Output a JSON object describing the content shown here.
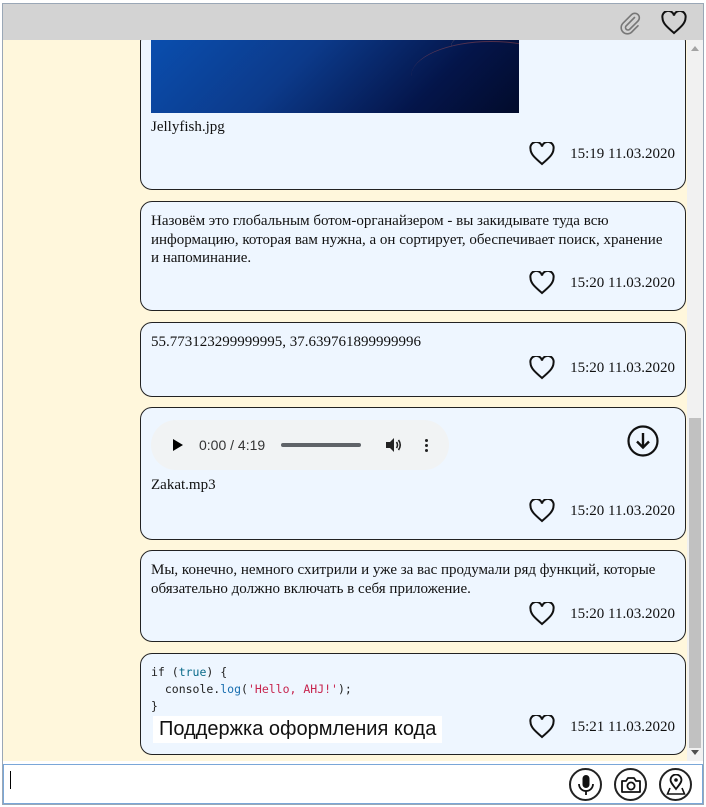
{
  "header": {
    "attach_icon": "paperclip-icon",
    "favorites_icon": "heart-icon"
  },
  "messages": [
    {
      "kind": "image",
      "filename": "Jellyfish.jpg",
      "time": "15:19 11.03.2020"
    },
    {
      "kind": "text",
      "text": "Назовём это глобальным ботом-органайзером - вы закидывате туда всю информацию, которая вам нужна, а он сортирует, обеспечивает поиск, хранение и напоминание.",
      "time": "15:20 11.03.2020"
    },
    {
      "kind": "text",
      "text": "55.773123299999995, 37.639761899999996",
      "time": "15:20 11.03.2020"
    },
    {
      "kind": "audio",
      "audio_time": "0:00 / 4:19",
      "filename": "Zakat.mp3",
      "time": "15:20 11.03.2020"
    },
    {
      "kind": "text",
      "text": "Мы, конечно, немного схитрили и уже за вас продумали ряд функций, которые обязательно должно включать в себя приложение.",
      "time": "15:20 11.03.2020"
    },
    {
      "kind": "code",
      "code_lines": [
        "if (true) {",
        "  console.log('Hello, AHJ!');",
        "}"
      ],
      "label": "Поддержка оформления кода",
      "time": "15:21 11.03.2020"
    }
  ],
  "input": {
    "value": "",
    "mic_icon": "microphone-icon",
    "camera_icon": "camera-icon",
    "location_icon": "location-pin-icon"
  }
}
